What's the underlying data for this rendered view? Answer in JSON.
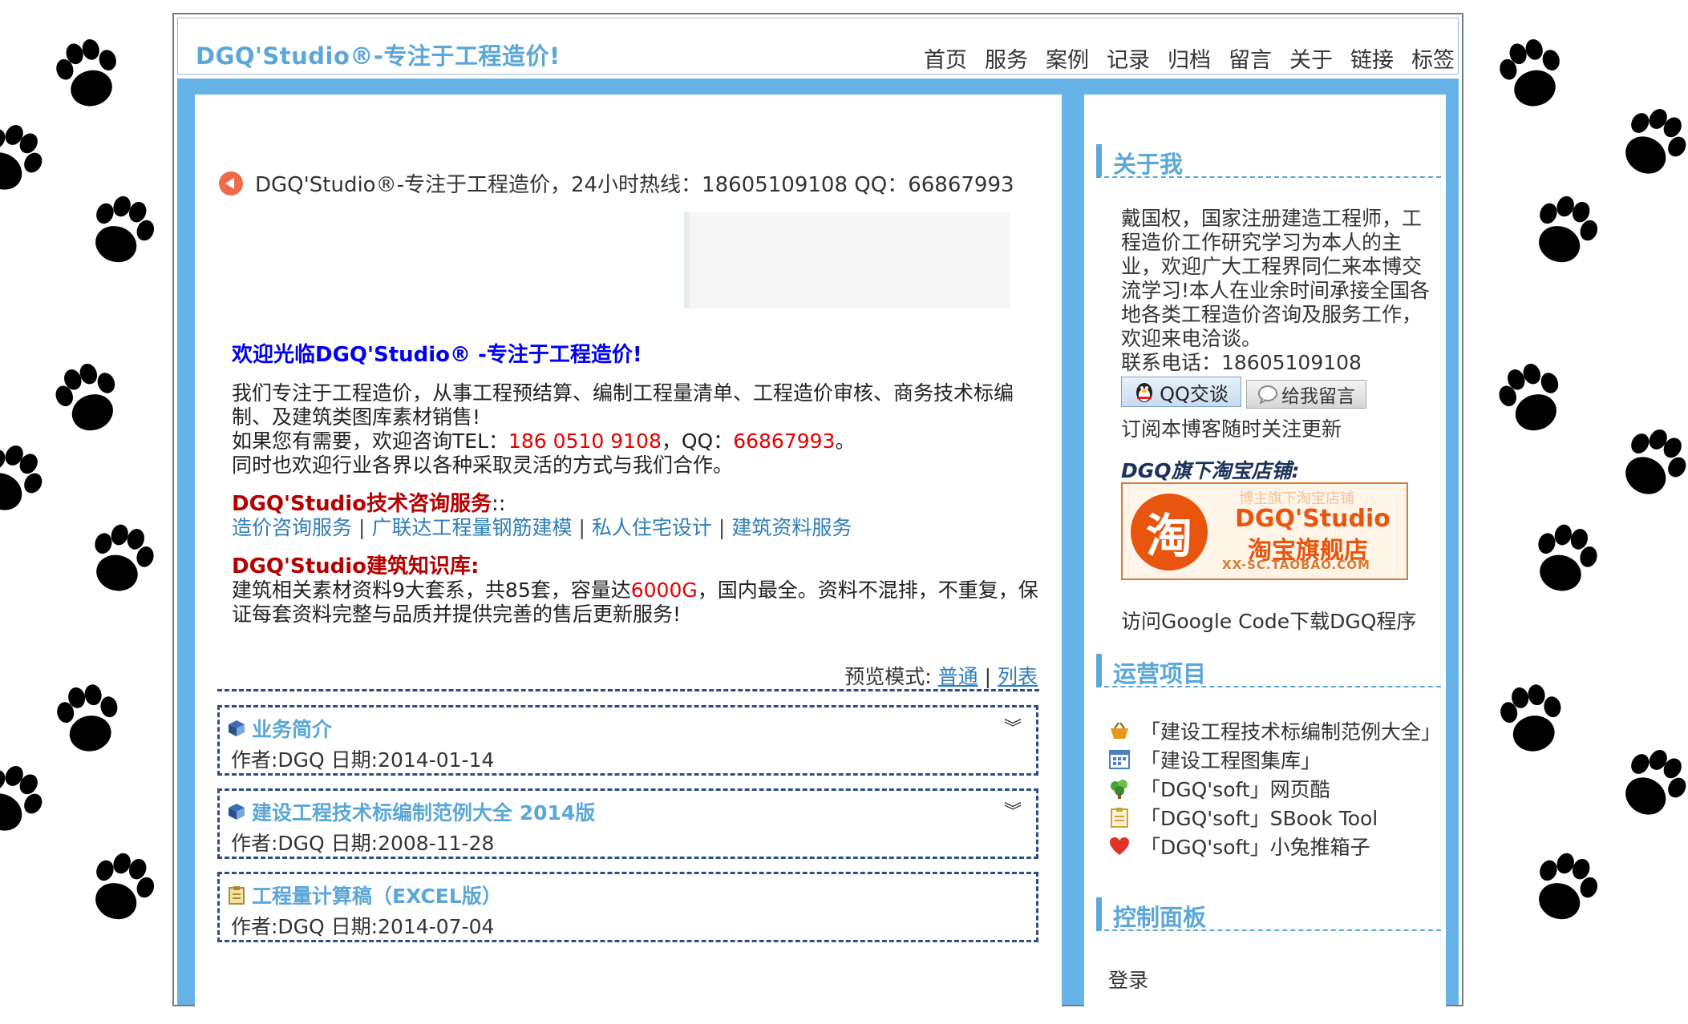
{
  "header": {
    "site_title": "DGQ'Studio®-专注于工程造价!",
    "nav": [
      "首页",
      "服务",
      "案例",
      "记录",
      "归档",
      "留言",
      "关于",
      "链接",
      "标签"
    ]
  },
  "notice": "DGQ'Studio®-专注于工程造价，24小时热线：18605109108 QQ：66867993",
  "intro": {
    "welcome": "欢迎光临DGQ'Studio® -专注于工程造价!",
    "line1": "我们专注于工程造价，从事工程预结算、编制工程量清单、工程造价审核、商务技术标编制、及建筑类图库素材销售!",
    "line2_prefix": "如果您有需要，欢迎咨询TEL：",
    "tel": "186 0510 9108",
    "line2_mid": "，QQ：",
    "qq": "66867993",
    "line2_suffix": "。",
    "line3": "同时也欢迎行业各界以各种采取灵活的方式与我们合作。",
    "service_title": "DGQ'Studio技术咨询服务",
    "service_colon": "::",
    "services": [
      "造价咨询服务",
      "广联达工程量钢筋建模",
      "私人住宅设计",
      "建筑资料服务"
    ],
    "kb_title": "DGQ'Studio建筑知识库:",
    "kb_prefix": "建筑相关素材资料9大套系，共85套，容量达",
    "kb_size": "6000G",
    "kb_suffix": "，国内最全。资料不混排，不重复，保证每套资料完整与品质并提供完善的售后更新服务!"
  },
  "preview": {
    "label": "预览模式:",
    "normal": "普通",
    "sep": "|",
    "list": "列表"
  },
  "posts": [
    {
      "title": "业务简介",
      "meta": "作者:DGQ 日期:2014-01-14",
      "toggle": "⌄"
    },
    {
      "title": "建设工程技术标编制范例大全 2014版",
      "meta": "作者:DGQ 日期:2008-11-28",
      "toggle": "⌄"
    },
    {
      "title": "工程量计算稿（EXCEL版）",
      "meta": "作者:DGQ 日期:2014-07-04",
      "toggle": ""
    }
  ],
  "sidebar": {
    "about_title": "关于我",
    "about_text": "戴国权，国家注册建造工程师，工程造价工作研究学习为本人的主业，欢迎广大工程界同仁来本博交流学习!本人在业余时间承接全国各地各类工程造价咨询及服务工作，欢迎来电洽谈。",
    "phone": "联系电话：18605109108",
    "qq_button": "QQ交谈",
    "msg_button": "给我留言",
    "subscribe": "订阅本博客随时关注更新",
    "shop_heading": "DGQ旗下淘宝店铺:",
    "shop": {
      "logo": "淘",
      "t1": "博主旗下淘宝店铺",
      "t2": "DGQ'Studio",
      "t3": "淘宝旗舰店",
      "t4": "XX-SC.TAOBAO.COM"
    },
    "gcode": "访问Google Code下载DGQ程序",
    "projects_title": "运营项目",
    "projects": [
      {
        "label": "「建设工程技术标编制范例大全」",
        "icon": "basket-icon",
        "color": "#e29a1c"
      },
      {
        "label": "「建设工程图集库」",
        "icon": "calendar-grid-icon",
        "color": "#4a7fc0"
      },
      {
        "label": "「DGQ'soft」网页酷",
        "icon": "plant-icon",
        "color": "#4aa33a"
      },
      {
        "label": "「DGQ'soft」SBook Tool",
        "icon": "clipboard-icon",
        "color": "#c8a23c"
      },
      {
        "label": "「DGQ'soft」小兔推箱子",
        "icon": "heart-icon",
        "color": "#e0332a"
      }
    ],
    "control_title": "控制面板",
    "login": "登录"
  },
  "colors": {
    "accent": "#5aa7d8",
    "frame": "#66b4e7",
    "link": "#2e7db8",
    "highlight_red": "#e60000",
    "dashed_border": "#2d4d86"
  }
}
